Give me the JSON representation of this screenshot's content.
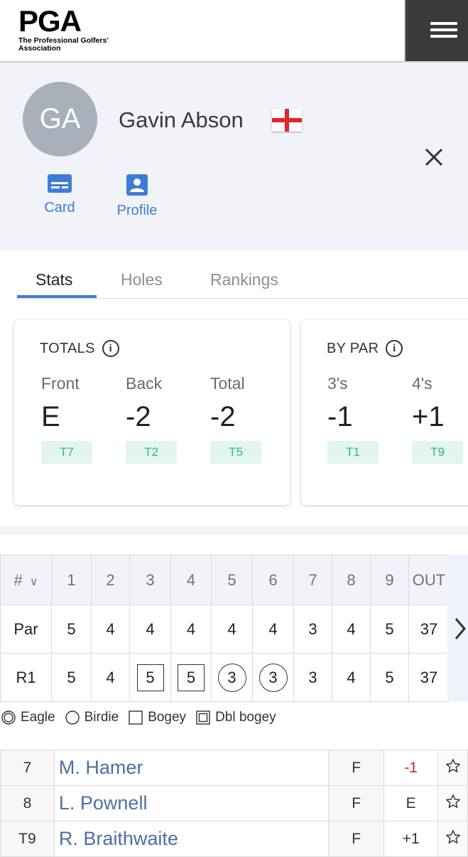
{
  "header": {
    "logo_text": "PGA",
    "logo_subtitle": "The Professional Golfers' Association",
    "menu_icon": "hamburger-menu-icon"
  },
  "player": {
    "initials": "GA",
    "name": "Gavin Abson",
    "flag": "england-flag-icon",
    "actions": [
      {
        "label": "Card",
        "icon": "scorecard-icon"
      },
      {
        "label": "Profile",
        "icon": "profile-icon"
      }
    ]
  },
  "tabs": [
    "Stats",
    "Holes",
    "Rankings"
  ],
  "totals": {
    "title": "TOTALS",
    "items": [
      {
        "label": "Front",
        "value": "E",
        "rank": "T7"
      },
      {
        "label": "Back",
        "value": "-2",
        "rank": "T2"
      },
      {
        "label": "Total",
        "value": "-2",
        "rank": "T5"
      }
    ]
  },
  "by_par": {
    "title": "BY PAR",
    "items": [
      {
        "label": "3's",
        "value": "-1",
        "rank": "T1"
      },
      {
        "label": "4's",
        "value": "+1",
        "rank": "T9"
      }
    ]
  },
  "scorecard": {
    "header_label": "#",
    "holes": [
      "1",
      "2",
      "3",
      "4",
      "5",
      "6",
      "7",
      "8",
      "9"
    ],
    "out_label": "OUT",
    "par_label": "Par",
    "par": [
      "5",
      "4",
      "4",
      "4",
      "4",
      "4",
      "3",
      "4",
      "5"
    ],
    "par_out": "37",
    "round_label": "R1",
    "r1": [
      "5",
      "4",
      "5",
      "5",
      "3",
      "3",
      "3",
      "4",
      "5"
    ],
    "r1_marks": [
      "",
      "",
      "bogey",
      "bogey",
      "birdie",
      "birdie",
      "",
      "",
      ""
    ],
    "r1_out": "37"
  },
  "legend": [
    "Eagle",
    "Birdie",
    "Bogey",
    "Dbl bogey"
  ],
  "leaderboard": [
    {
      "pos": "7",
      "name": "M. Hamer",
      "thru": "F",
      "score": "-1"
    },
    {
      "pos": "8",
      "name": "L. Pownell",
      "thru": "F",
      "score": "E"
    },
    {
      "pos": "T9",
      "name": "R. Braithwaite",
      "thru": "F",
      "score": "+1"
    }
  ],
  "colors": {
    "accent": "#3e7dd6",
    "rank_bg": "#e2f5ee",
    "rank_text": "#33b58c",
    "negative_score": "#cf2a27"
  }
}
